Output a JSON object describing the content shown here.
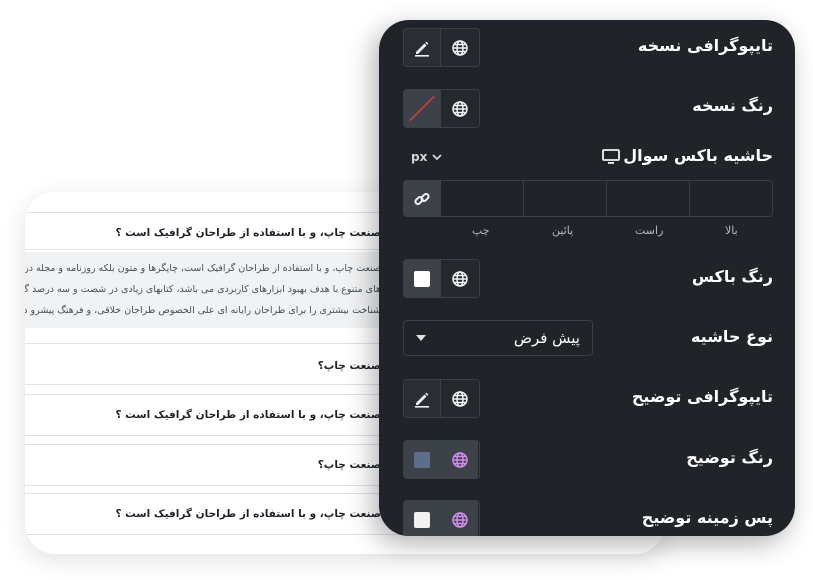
{
  "preview": {
    "items": [
      {
        "question": "صنعت چاپ، و با استفاده از طراحان گرافیک است ؟",
        "open": true
      },
      {
        "question": "صنعت چاپ؟",
        "open": false
      },
      {
        "question": "صنعت چاپ، و با استفاده از طراحان گرافیک است ؟",
        "open": false
      },
      {
        "question": "صنعت چاپ؟",
        "open": false
      },
      {
        "question": "صنعت چاپ، و با استفاده از طراحان گرافیک است ؟",
        "open": false
      }
    ],
    "answer_lines": [
      "صنعت چاپ، و با استفاده از طراحان گرافیک است، چاپگرها و متون بلکه روزنامه و مجله در ستو",
      "های متنوع با هدف بهبود ابزارهای کاربردی می باشد، کتابهای زیادی در شصت و سه درصد گذشـ",
      "شناخت بیشتری را برای طراحان رایانه ای علی الخصوص طراحان خلاقی، و فرهنگ پیشرو در زبان فارس"
    ]
  },
  "settings": {
    "rows": {
      "body_typography": "تایپوگرافی نسخه",
      "body_color": "رنگ نسخه",
      "question_box_border": "حاشیه باکس سوال",
      "box_color": "رنگ باکس",
      "border_type": "نوع حاشیه",
      "description_typography": "تایپوگرافی توضیح",
      "description_color": "رنگ توضیح",
      "description_background": "پس زمینه توضیح"
    },
    "unit": "px",
    "dimension_labels": {
      "top": "بالا",
      "right": "راست",
      "bottom": "پائین",
      "left": "چپ"
    },
    "border_type_value": "پیش فرض",
    "colors": {
      "box_color": "#ffffff",
      "description_color": "#5b6e8c",
      "description_background": "#f2f2f2",
      "global_active": "#d18bea"
    }
  }
}
